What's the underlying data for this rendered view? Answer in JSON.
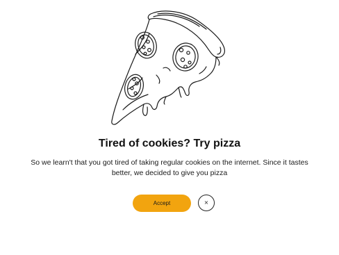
{
  "dialog": {
    "illustration_icon": "pizza-slice-icon",
    "title": "Tired of cookies? Try pizza",
    "message": "So we learn't that you got tired of taking regular cookies on the internet. Since it tastes better, we decided to give you pizza",
    "accept_label": "Accept",
    "close_icon": "×"
  },
  "colors": {
    "accent": "#f2a40f",
    "text": "#111111",
    "background": "#ffffff"
  }
}
